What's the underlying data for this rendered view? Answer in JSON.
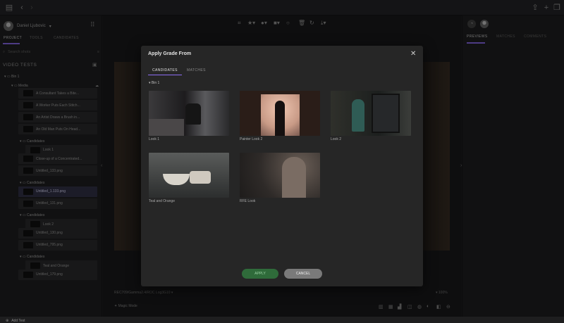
{
  "left_panel": {
    "user_name": "Daniel Ljubovic",
    "tabs": [
      "PROJECT",
      "TOOLS",
      "CANDIDATES"
    ],
    "search_placeholder": "Search shots",
    "section_title": "VIDEO TESTS",
    "tree": {
      "bin": "Bin 1",
      "media": "Media",
      "rows": [
        {
          "type": "clip",
          "label": "A Consultant Takes a Bite..."
        },
        {
          "type": "clip",
          "label": "A Worker Puts Each Stitch..."
        },
        {
          "type": "clip",
          "label": "An Artist Draws a Brush in..."
        },
        {
          "type": "clip",
          "label": "An Old Man Puts On Head..."
        },
        {
          "type": "folder",
          "label": "Candidates"
        },
        {
          "type": "clip",
          "label": "Look 1",
          "indent": true
        },
        {
          "type": "clip",
          "label": "Close-up of a Concentrated..."
        },
        {
          "type": "clip",
          "label": "Untitled_133.png"
        },
        {
          "type": "folder",
          "label": "Candidates"
        },
        {
          "type": "clip",
          "label": "Untitled_1.133.png",
          "selected": true
        },
        {
          "type": "clip",
          "label": "Untitled_131.png"
        },
        {
          "type": "folder",
          "label": "Candidates"
        },
        {
          "type": "clip",
          "label": "Look 2",
          "indent": true
        },
        {
          "type": "clip",
          "label": "Untitled_130.png"
        },
        {
          "type": "clip",
          "label": "Untitled_795.png"
        },
        {
          "type": "folder",
          "label": "Candidates"
        },
        {
          "type": "clip",
          "label": "Teal and Orange",
          "indent": true
        },
        {
          "type": "clip",
          "label": "Untitled_179.png"
        }
      ]
    },
    "add_test": "Add Test"
  },
  "center": {
    "color_space": "REC709/Gamma2.4/ROC Log3G10",
    "zoom": "100%",
    "magic_mode": "Magic Mode"
  },
  "right_panel": {
    "tabs": [
      "PREVIEWS",
      "MATCHES",
      "COMMENTS"
    ]
  },
  "modal": {
    "title": "Apply Grade From",
    "tabs": [
      "CANDIDATES",
      "MATCHES"
    ],
    "bin_label": "Bin 1",
    "cards": [
      {
        "label": "Look 1"
      },
      {
        "label": "Painter Look 2"
      },
      {
        "label": "Look 2"
      },
      {
        "label": "Teal and Orange"
      },
      {
        "label": "RFE Look"
      }
    ],
    "apply_label": "APPLY",
    "cancel_label": "CANCEL"
  },
  "colors": {
    "accent": "#8c6cf2",
    "apply": "#2f6b3a",
    "cancel": "#7a7a7a"
  }
}
